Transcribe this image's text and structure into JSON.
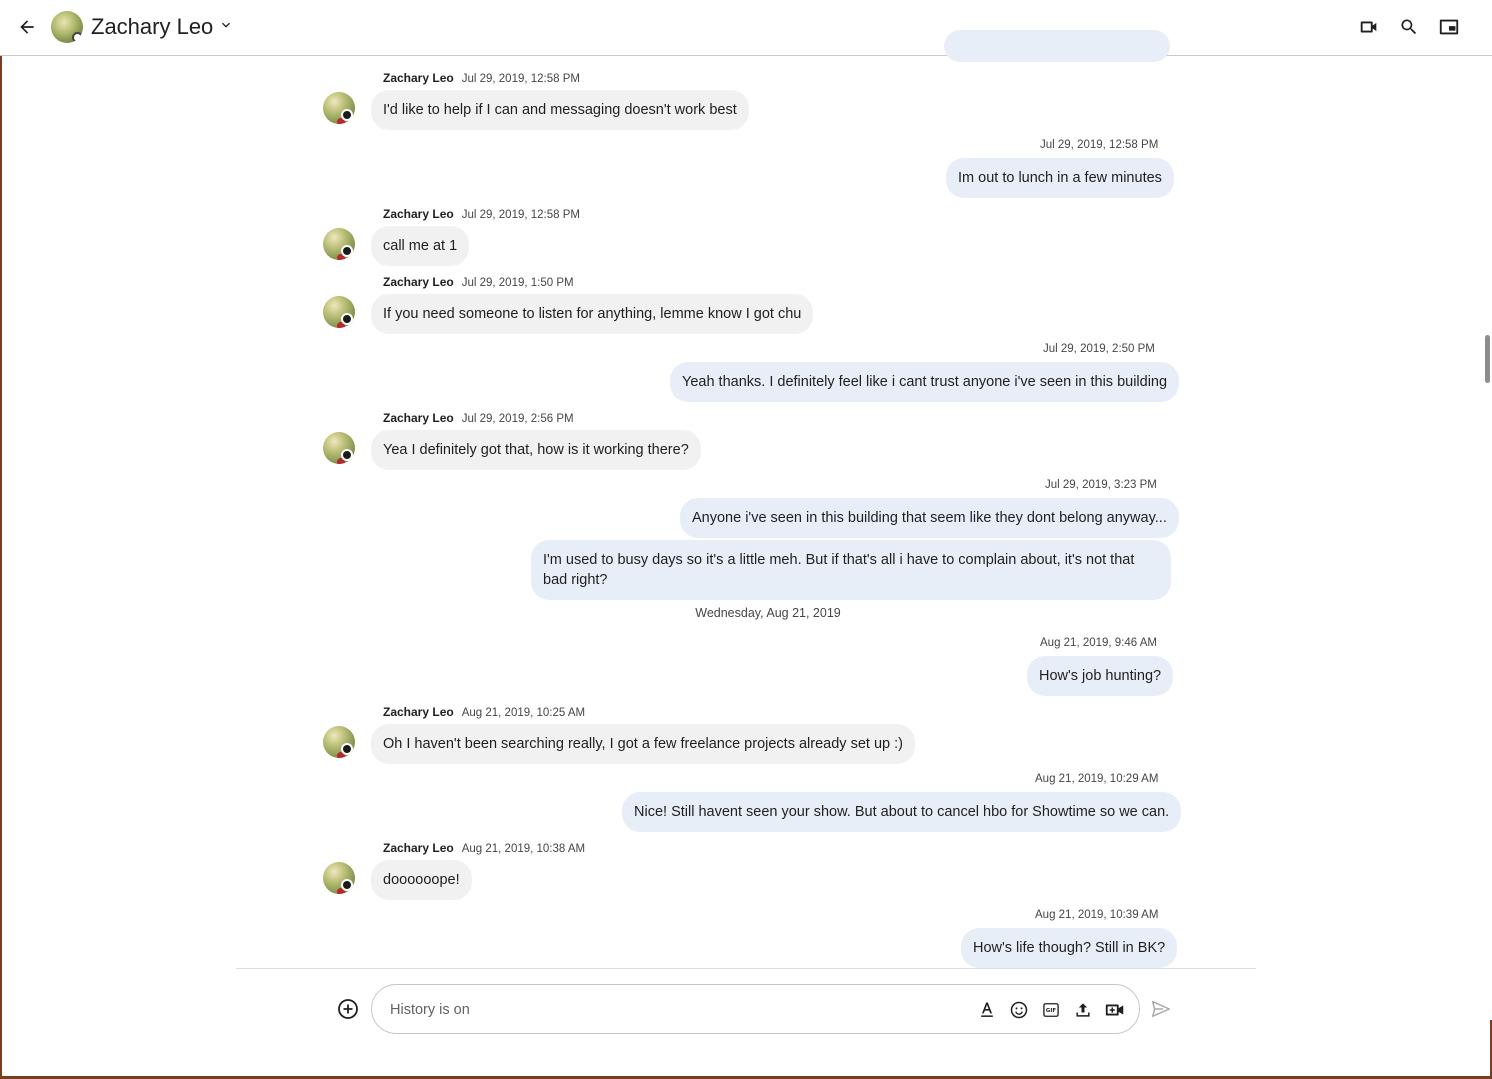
{
  "header": {
    "contact_name": "Zachary Leo",
    "icons": [
      "back-arrow-icon",
      "chevron-down-icon",
      "video-call-icon",
      "search-icon",
      "picture-in-picture-icon"
    ]
  },
  "messages": [
    {
      "direction": "in",
      "sender": "Zachary Leo",
      "time": "Jul 29, 2019, 12:58 PM",
      "text": "I'd like to help if I can and messaging doesn't work best"
    },
    {
      "direction": "out",
      "time": "Jul 29, 2019, 12:58 PM",
      "text": "Im out to lunch in a few minutes"
    },
    {
      "direction": "in",
      "sender": "Zachary Leo",
      "time": "Jul 29, 2019, 12:58 PM",
      "text": "call me at 1"
    },
    {
      "direction": "in",
      "sender": "Zachary Leo",
      "time": "Jul 29, 2019, 1:50 PM",
      "text": "If you need someone to listen for anything, lemme know I got chu"
    },
    {
      "direction": "out",
      "time": "Jul 29, 2019, 2:50 PM",
      "text": "Yeah thanks. I definitely feel like i cant trust anyone i've seen in this building"
    },
    {
      "direction": "in",
      "sender": "Zachary Leo",
      "time": "Jul 29, 2019, 2:56 PM",
      "text": "Yea I definitely got that, how is it working there?"
    },
    {
      "direction": "out",
      "time": "Jul 29, 2019, 3:23 PM",
      "text": "Anyone i've seen in this building that seem like they dont belong anyway..."
    },
    {
      "direction": "out",
      "text": "I'm used to busy days so it's a little meh. But if that's all i have to complain about, it's not that bad right?"
    },
    {
      "type": "date_separator",
      "text": "Wednesday, Aug 21, 2019"
    },
    {
      "direction": "out",
      "time": "Aug 21, 2019, 9:46 AM",
      "text": "How's job hunting?"
    },
    {
      "direction": "in",
      "sender": "Zachary Leo",
      "time": "Aug 21, 2019, 10:25 AM",
      "text": "Oh I haven't been searching really, I got a few freelance projects already set up :)"
    },
    {
      "direction": "out",
      "time": "Aug 21, 2019, 10:29 AM",
      "text": "Nice! Still havent seen your show. But about to cancel hbo for Showtime so we can."
    },
    {
      "direction": "in",
      "sender": "Zachary Leo",
      "time": "Aug 21, 2019, 10:38 AM",
      "text": "doooooope!"
    },
    {
      "direction": "out",
      "time": "Aug 21, 2019, 10:39 AM",
      "text": "How's life though? Still in BK?"
    }
  ],
  "composer": {
    "placeholder": "History is on",
    "icons": [
      "add-circle-icon",
      "text-format-icon",
      "emoji-icon",
      "gif-icon",
      "upload-icon",
      "video-meeting-icon",
      "send-icon"
    ]
  }
}
